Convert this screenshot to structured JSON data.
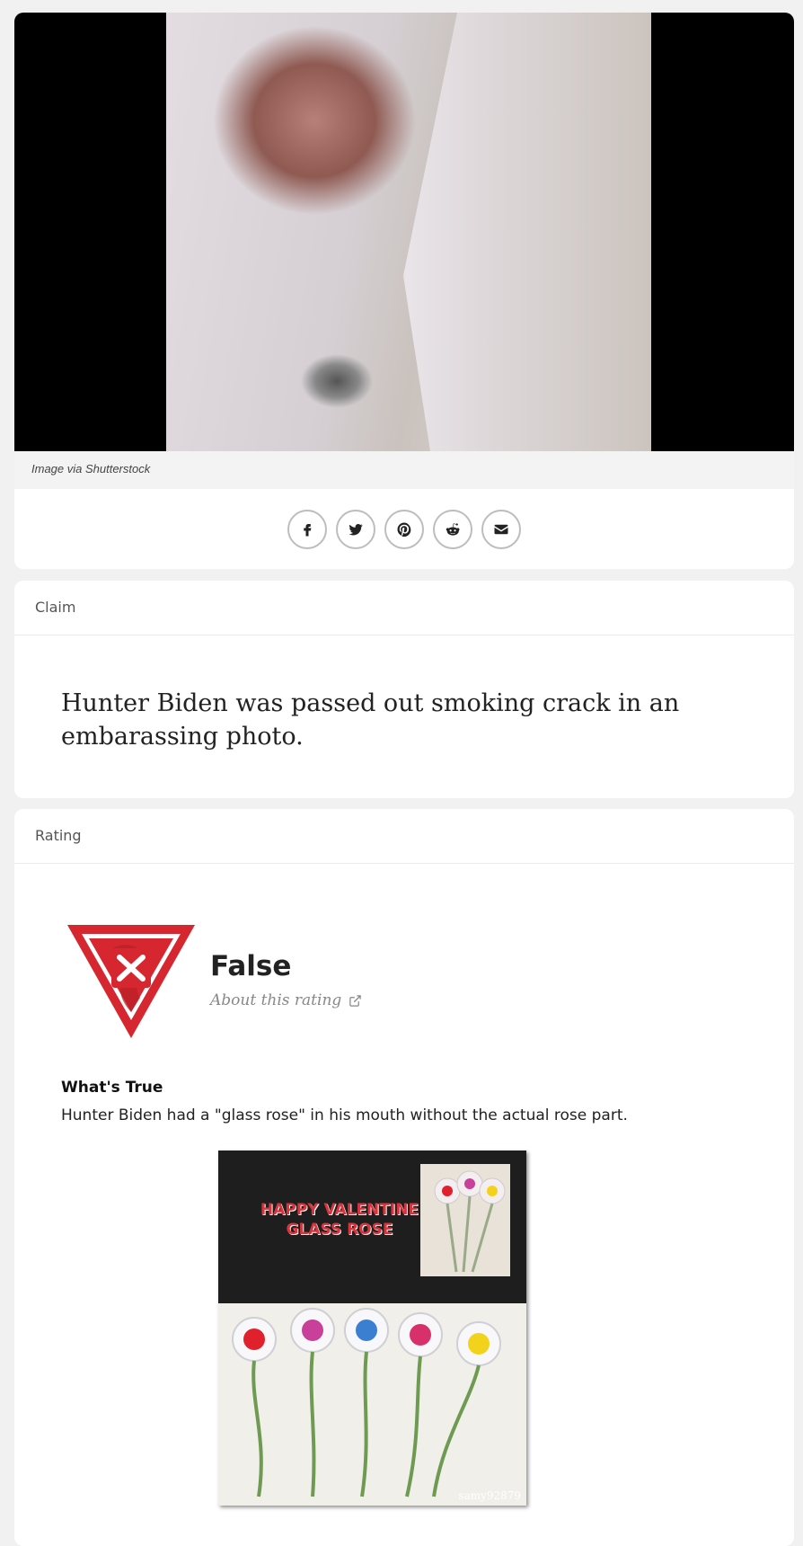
{
  "image_card": {
    "caption": "Image via Shutterstock",
    "share_buttons": [
      {
        "icon": "facebook-icon"
      },
      {
        "icon": "twitter-icon"
      },
      {
        "icon": "pinterest-icon"
      },
      {
        "icon": "reddit-icon"
      },
      {
        "icon": "email-icon"
      }
    ]
  },
  "claim": {
    "label": "Claim",
    "text": "Hunter Biden was passed out smoking crack in an embarassing photo."
  },
  "rating": {
    "label": "Rating",
    "value": "False",
    "about_link": "About this rating",
    "badge_color": "#d6262f",
    "whats_true_title": "What's True",
    "whats_true_text": "Hunter Biden had a \"glass rose\" in his mouth without the actual rose part.",
    "product_image": {
      "box_text_line1": "HAPPY VALENTINE",
      "box_text_line2": "GLASS ROSE",
      "watermark": "samy92879",
      "rose_colors": [
        "#e0202c",
        "#c8409a",
        "#3a7fd0",
        "#d8306a",
        "#f2d21a"
      ]
    }
  }
}
